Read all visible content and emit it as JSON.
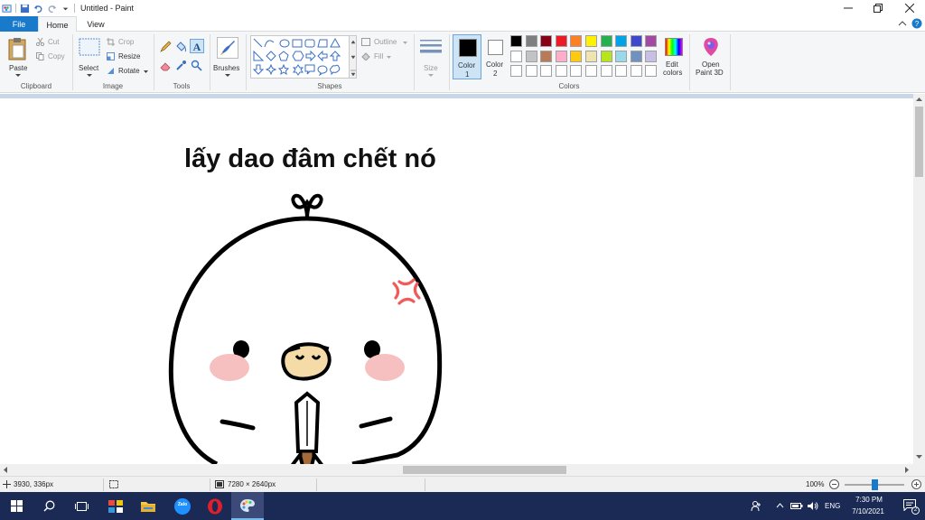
{
  "window": {
    "title": "Untitled - Paint"
  },
  "tabs": {
    "file": "File",
    "home": "Home",
    "view": "View"
  },
  "clipboard": {
    "paste": "Paste",
    "cut": "Cut",
    "copy": "Copy",
    "group": "Clipboard"
  },
  "image": {
    "select": "Select",
    "crop": "Crop",
    "resize": "Resize",
    "rotate": "Rotate",
    "group": "Image"
  },
  "tools": {
    "group": "Tools"
  },
  "brushes": {
    "label": "Brushes"
  },
  "shapes": {
    "group": "Shapes",
    "outline": "Outline",
    "fill": "Fill"
  },
  "size": {
    "label": "Size"
  },
  "colors": {
    "color1": "Color",
    "color1_num": "1",
    "color2": "Color",
    "color2_num": "2",
    "group": "Colors",
    "edit": "Edit",
    "edit2": "colors",
    "open3d": "Open",
    "open3d2": "Paint 3D",
    "palette_row1": [
      "#000000",
      "#7f7f7f",
      "#880015",
      "#ed1c24",
      "#ff7f27",
      "#fff200",
      "#22b14c",
      "#00a2e8",
      "#3f48cc",
      "#a349a4"
    ],
    "palette_row2": [
      "#ffffff",
      "#c3c3c3",
      "#b97a57",
      "#ffaec9",
      "#ffc90e",
      "#efe4b0",
      "#b5e61d",
      "#99d9ea",
      "#7092be",
      "#c8bfe7"
    ],
    "palette_row3": [
      "#ffffff",
      "#ffffff",
      "#ffffff",
      "#ffffff",
      "#ffffff",
      "#ffffff",
      "#ffffff",
      "#ffffff",
      "#ffffff",
      "#ffffff"
    ]
  },
  "canvas": {
    "caption": "lấy dao đâm chết nó"
  },
  "status": {
    "cursor": "3930, 336px",
    "dimensions": "7280 × 2640px",
    "zoom": "100%"
  },
  "taskbar": {
    "lang": "ENG",
    "time": "7:30 PM",
    "date": "7/10/2021",
    "notif_count": "2",
    "zalo": "Zalo"
  }
}
